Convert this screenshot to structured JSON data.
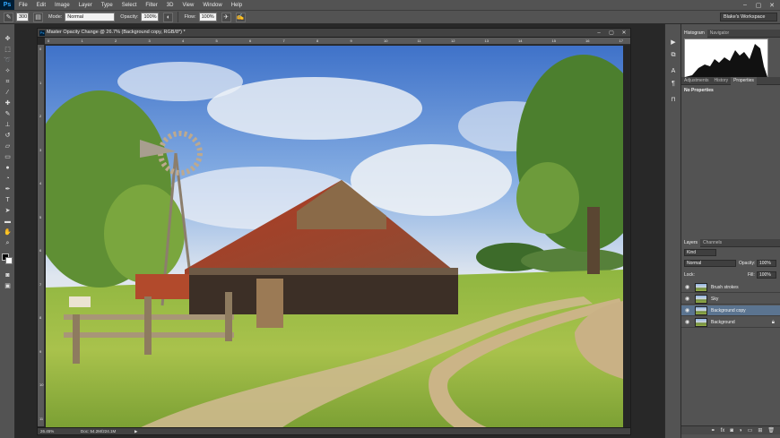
{
  "app": {
    "logo": "Ps"
  },
  "menubar": {
    "items": [
      "File",
      "Edit",
      "Image",
      "Layer",
      "Type",
      "Select",
      "Filter",
      "3D",
      "View",
      "Window",
      "Help"
    ],
    "window_controls": [
      "–",
      "▢",
      "✕"
    ]
  },
  "options_bar": {
    "brush_size": "300",
    "mode_label": "Mode:",
    "mode_value": "Normal",
    "opacity_label": "Opacity:",
    "opacity_value": "100%",
    "flow_label": "Flow:",
    "flow_value": "100%",
    "workspace": "Blake's Workspace"
  },
  "document": {
    "title": "Master Opacity Change @ 26.7% (Background copy, RGB/8*) *",
    "zoom": "26.45%",
    "doc_size": "Doc: 54.2M/224.1M",
    "ruler_top_ticks": [
      "0",
      "1",
      "2",
      "3",
      "4",
      "5",
      "6",
      "7",
      "8",
      "9",
      "10",
      "11",
      "12",
      "13",
      "14",
      "15",
      "16",
      "17"
    ],
    "ruler_left_ticks": [
      "0",
      "1",
      "2",
      "3",
      "4",
      "5",
      "6",
      "7",
      "8",
      "9",
      "10",
      "11"
    ]
  },
  "panels": {
    "top_tabs": [
      "Histogram",
      "Navigator"
    ],
    "mid_tabs": [
      "Adjustments",
      "History",
      "Properties"
    ],
    "properties_message": "No Properties",
    "layers_tabs": [
      "Layers",
      "Channels"
    ],
    "kind_label": "Kind",
    "blend_mode": "Normal",
    "opacity_label": "Opacity:",
    "opacity_value": "100%",
    "lock_label": "Lock:",
    "fill_label": "Fill:",
    "fill_value": "100%",
    "layers": [
      {
        "name": "Brush strokes",
        "selected": false,
        "locked": false
      },
      {
        "name": "Sky",
        "selected": false,
        "locked": false
      },
      {
        "name": "Background copy",
        "selected": true,
        "locked": false
      },
      {
        "name": "Background",
        "selected": false,
        "locked": true
      }
    ]
  },
  "colors": {
    "ui_panel": "#535353",
    "ui_dark": "#282828",
    "selected_layer": "#5b7490",
    "ps_blue": "#31a8ff"
  }
}
